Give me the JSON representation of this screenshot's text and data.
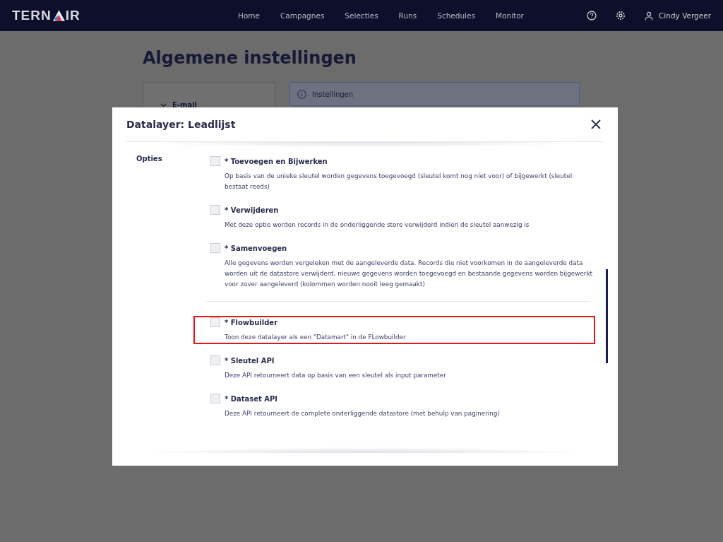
{
  "nav": {
    "logo": [
      "TERN",
      "IR"
    ],
    "links": [
      {
        "label": "Home",
        "selected": false
      },
      {
        "label": "Campagnes",
        "selected": false
      },
      {
        "label": "Selecties",
        "selected": false
      },
      {
        "label": "Runs",
        "selected": false
      },
      {
        "label": "Schedules",
        "selected": false
      },
      {
        "label": "Monitor",
        "selected": false
      }
    ],
    "user": "Cindy Vergeer"
  },
  "page": {
    "title": "Algemene instellingen",
    "sidebar_item": "E-mail",
    "info": "Instellingen"
  },
  "modal": {
    "title": "Datalayer: Leadlijst",
    "section_label": "Opties",
    "groups": [
      [
        {
          "label": "* Toevoegen en Bijwerken",
          "description": "Op basis van de unieke sleutel worden gegevens toegevoegd (sleutel komt nog niet voor) of bijgewerkt (sleutel bestaat reeds)",
          "checked": false,
          "highlighted": false
        },
        {
          "label": "* Verwijderen",
          "description": "Met deze optie worden records in de onderliggende store verwijderd indien de sleutel aanwezig is",
          "checked": false,
          "highlighted": false
        },
        {
          "label": "* Samenvoegen",
          "description": "Alle gegevens worden vergeleken met de aangeleverde data. Records die niet voorkomen in de aangeleverde data worden uit de datastore verwijderd, nieuwe gegevens worden toegevoegd en bestaande gegevens worden bijgewerkt voor zover aangeleverd (kolommen worden nooit leeg gemaakt)",
          "checked": false,
          "highlighted": false
        }
      ],
      [
        {
          "label": "* Flowbuilder",
          "description": "Toon deze datalayer als een \"Datamart\" in de FLowbuilder",
          "checked": false,
          "highlighted": true
        },
        {
          "label": "* Sleutel API",
          "description": "Deze API retourneert data op basis van een sleutel als input parameter",
          "checked": false,
          "highlighted": false
        },
        {
          "label": "* Dataset API",
          "description": "Deze API retourneert de complete onderliggende datastore (met behulp van paginering)",
          "checked": false,
          "highlighted": false
        }
      ]
    ]
  }
}
